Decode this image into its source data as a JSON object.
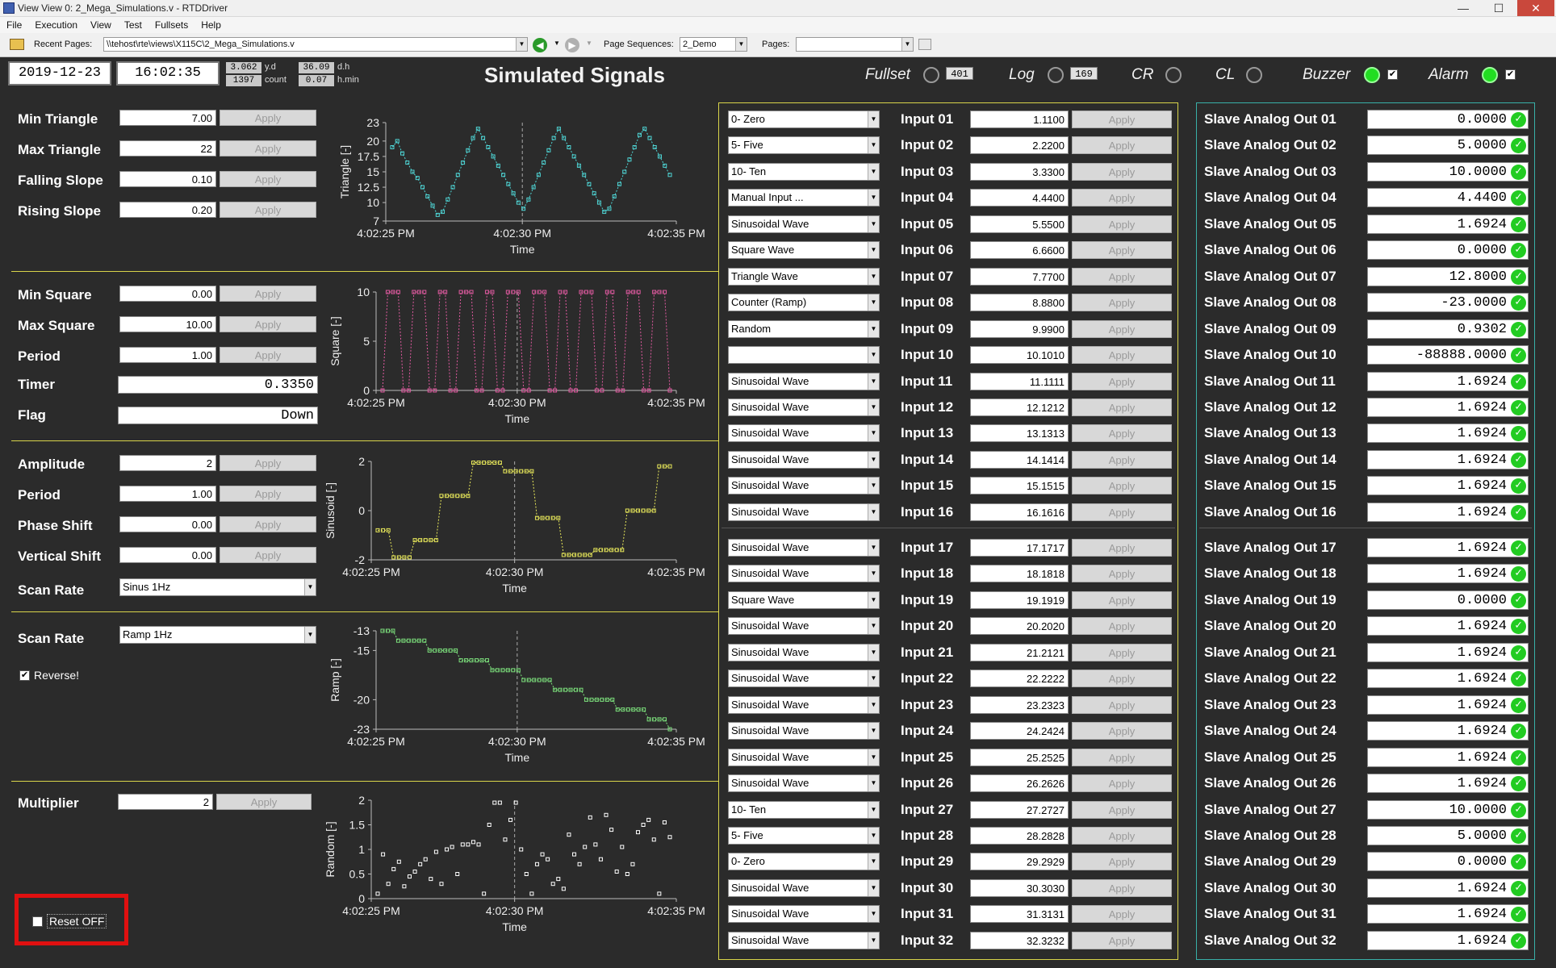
{
  "window": {
    "title": "View View 0: 2_Mega_Simulations.v - RTDDriver",
    "minimize": "—",
    "maximize": "☐",
    "close": "✕"
  },
  "menu": [
    "File",
    "Execution",
    "View",
    "Test",
    "Fullsets",
    "Help"
  ],
  "toolbar": {
    "recent_label": "Recent Pages:",
    "recent_value": "\\\\tehost\\rte\\views\\X115C\\2_Mega_Simulations.v",
    "page_seq_label": "Page Sequences:",
    "page_seq_value": "2_Demo",
    "pages_label": "Pages:",
    "pages_value": ""
  },
  "header": {
    "date": "2019-12-23",
    "time": "16:02:35",
    "yd": "3.062",
    "yd_unit": "y.d",
    "count": "1397",
    "count_unit": "count",
    "dh": "36.09",
    "dh_unit": "d.h",
    "hmin": "0.07",
    "hmin_unit": "h.min",
    "title": "Simulated Signals",
    "fullset_label": "Fullset",
    "fullset_value": "401",
    "log_label": "Log",
    "log_value": "169",
    "cr_label": "CR",
    "cl_label": "CL",
    "buzzer_label": "Buzzer",
    "alarm_label": "Alarm",
    "check_glyph": "✔"
  },
  "triangle": {
    "fields": [
      {
        "label": "Min Triangle",
        "value": "7.00"
      },
      {
        "label": "Max Triangle",
        "value": "22"
      },
      {
        "label": "Falling Slope",
        "value": "0.10"
      },
      {
        "label": "Rising Slope",
        "value": "0.20"
      }
    ]
  },
  "square": {
    "fields": [
      {
        "label": "Min Square",
        "value": "0.00"
      },
      {
        "label": "Max Square",
        "value": "10.00"
      },
      {
        "label": "Period",
        "value": "1.00"
      }
    ],
    "timer_label": "Timer",
    "timer_value": "0.3350",
    "flag_label": "Flag",
    "flag_value": "Down"
  },
  "sinus": {
    "fields": [
      {
        "label": "Amplitude",
        "value": "2"
      },
      {
        "label": "Period",
        "value": "1.00"
      },
      {
        "label": "Phase Shift",
        "value": "0.00"
      },
      {
        "label": "Vertical Shift",
        "value": "0.00"
      }
    ],
    "scan_label": "Scan Rate",
    "scan_value": "Sinus 1Hz"
  },
  "ramp": {
    "scan_label": "Scan Rate",
    "scan_value": "Ramp 1Hz",
    "reverse_label": "Reverse!"
  },
  "random": {
    "multiplier_label": "Multiplier",
    "multiplier_value": "2"
  },
  "apply_label": "Apply",
  "reset_label": "Reset OFF",
  "chart_data": [
    {
      "type": "line",
      "ylabel": "Triangle [-]",
      "xlabel": "Time",
      "xticks": [
        "4:02:25 PM",
        "4:02:30 PM",
        "4:02:35 PM"
      ],
      "yticks": [
        "7",
        "10",
        "12.5",
        "15",
        "17.5",
        "20",
        "23"
      ],
      "ylim": [
        7,
        23
      ],
      "color": "#4fd6d6",
      "values": [
        19,
        20,
        18,
        16.5,
        15,
        14,
        12.5,
        11,
        9.5,
        8,
        8.5,
        10.5,
        12.5,
        14.5,
        16.5,
        18.5,
        20.5,
        22,
        20.5,
        19,
        17.5,
        16,
        14.5,
        13,
        11.5,
        10,
        9,
        10.5,
        12.5,
        14.5,
        16.5,
        18.5,
        20.5,
        22,
        20.5,
        19,
        17.5,
        16,
        14.5,
        13,
        11.5,
        10,
        8.5,
        9,
        11,
        13,
        15,
        17,
        19,
        21,
        22,
        20.5,
        19,
        17.5,
        16,
        14.5
      ]
    },
    {
      "type": "line",
      "ylabel": "Square [-]",
      "xlabel": "Time",
      "xticks": [
        "4:02:25 PM",
        "4:02:30 PM",
        "4:02:35 PM"
      ],
      "yticks": [
        "0",
        "5",
        "10"
      ],
      "ylim": [
        0,
        10
      ],
      "color": "#e05aa0",
      "values": [
        0,
        10,
        10,
        10,
        0,
        0,
        10,
        10,
        10,
        0,
        0,
        10,
        10,
        0,
        0,
        10,
        10,
        10,
        0,
        0,
        10,
        10,
        0,
        0,
        10,
        10,
        10,
        0,
        0,
        10,
        10,
        10,
        0,
        0,
        10,
        10,
        0,
        0,
        10,
        10,
        10,
        0,
        0,
        10,
        10,
        0,
        0,
        10,
        10,
        10,
        0,
        0,
        10,
        10,
        10,
        0
      ]
    },
    {
      "type": "line",
      "ylabel": "Sinusoid [-]",
      "xlabel": "Time",
      "xticks": [
        "4:02:25 PM",
        "4:02:30 PM",
        "4:02:35 PM"
      ],
      "yticks": [
        "-2",
        "0",
        "2"
      ],
      "ylim": [
        -2,
        2
      ],
      "color": "#e8e85a",
      "values": [
        -0.8,
        -0.8,
        -0.8,
        -1.9,
        -1.9,
        -1.9,
        -1.9,
        -1.2,
        -1.2,
        -1.2,
        -1.2,
        -1.2,
        0.6,
        0.6,
        0.6,
        0.6,
        0.6,
        0.6,
        1.95,
        1.95,
        1.95,
        1.95,
        1.95,
        1.95,
        1.6,
        1.6,
        1.6,
        1.6,
        1.6,
        1.6,
        -0.3,
        -0.3,
        -0.3,
        -0.3,
        -0.3,
        -1.8,
        -1.8,
        -1.8,
        -1.8,
        -1.8,
        -1.8,
        -1.6,
        -1.6,
        -1.6,
        -1.6,
        -1.6,
        -1.6,
        0,
        0,
        0,
        0,
        0,
        0,
        1.8,
        1.8,
        1.8
      ]
    },
    {
      "type": "line",
      "ylabel": "Ramp [-]",
      "xlabel": "Time",
      "xticks": [
        "4:02:25 PM",
        "4:02:30 PM",
        "4:02:35 PM"
      ],
      "yticks": [
        "-13",
        "-15",
        "-20",
        "-23"
      ],
      "ylim": [
        -23,
        -13
      ],
      "color": "#7ce07c",
      "values": [
        -13,
        -13,
        -13,
        -14,
        -14,
        -14,
        -14,
        -14,
        -14,
        -15,
        -15,
        -15,
        -15,
        -15,
        -15,
        -16,
        -16,
        -16,
        -16,
        -16,
        -16,
        -17,
        -17,
        -17,
        -17,
        -17,
        -17,
        -18,
        -18,
        -18,
        -18,
        -18,
        -18,
        -19,
        -19,
        -19,
        -19,
        -19,
        -19,
        -20,
        -20,
        -20,
        -20,
        -20,
        -20,
        -21,
        -21,
        -21,
        -21,
        -21,
        -21,
        -22,
        -22,
        -22,
        -22,
        -23
      ]
    },
    {
      "type": "scatter",
      "ylabel": "Random [-]",
      "xlabel": "Time",
      "xticks": [
        "4:02:25 PM",
        "4:02:30 PM",
        "4:02:35 PM"
      ],
      "yticks": [
        "0",
        "0.5",
        "1",
        "1.5",
        "2"
      ],
      "ylim": [
        0,
        2
      ],
      "color": "#ffffff",
      "values": [
        0.1,
        0.9,
        0.3,
        0.6,
        0.75,
        0.25,
        0.45,
        0.55,
        0.7,
        0.8,
        0.4,
        0.95,
        0.3,
        1.0,
        1.05,
        0.5,
        1.1,
        1.1,
        1.15,
        1.1,
        0.1,
        1.5,
        1.95,
        1.95,
        1.2,
        1.6,
        1.95,
        1.0,
        0.5,
        0.1,
        0.7,
        0.9,
        0.8,
        0.3,
        0.4,
        0.2,
        1.3,
        0.9,
        0.7,
        1.05,
        1.65,
        1.1,
        0.8,
        1.7,
        1.4,
        0.55,
        1.05,
        0.5,
        0.7,
        1.35,
        1.5,
        1.6,
        1.2,
        0.1,
        1.55,
        1.25
      ]
    }
  ],
  "inputs": [
    {
      "mode": "0- Zero",
      "label": "Input 01",
      "value": "1.1100"
    },
    {
      "mode": "5- Five",
      "label": "Input 02",
      "value": "2.2200"
    },
    {
      "mode": "10- Ten",
      "label": "Input 03",
      "value": "3.3300"
    },
    {
      "mode": "Manual Input ...",
      "label": "Input 04",
      "value": "4.4400"
    },
    {
      "mode": "Sinusoidal Wave",
      "label": "Input 05",
      "value": "5.5500"
    },
    {
      "mode": "Square Wave",
      "label": "Input 06",
      "value": "6.6600"
    },
    {
      "mode": "Triangle Wave",
      "label": "Input 07",
      "value": "7.7700"
    },
    {
      "mode": "Counter (Ramp)",
      "label": "Input 08",
      "value": "8.8800"
    },
    {
      "mode": "Random",
      "label": "Input 09",
      "value": "9.9900"
    },
    {
      "mode": "",
      "label": "Input 10",
      "value": "10.1010"
    },
    {
      "mode": "Sinusoidal Wave",
      "label": "Input 11",
      "value": "11.1111"
    },
    {
      "mode": "Sinusoidal Wave",
      "label": "Input 12",
      "value": "12.1212"
    },
    {
      "mode": "Sinusoidal Wave",
      "label": "Input 13",
      "value": "13.1313"
    },
    {
      "mode": "Sinusoidal Wave",
      "label": "Input 14",
      "value": "14.1414"
    },
    {
      "mode": "Sinusoidal Wave",
      "label": "Input 15",
      "value": "15.1515"
    },
    {
      "mode": "Sinusoidal Wave",
      "label": "Input 16",
      "value": "16.1616"
    },
    {
      "mode": "Sinusoidal Wave",
      "label": "Input 17",
      "value": "17.1717"
    },
    {
      "mode": "Sinusoidal Wave",
      "label": "Input 18",
      "value": "18.1818"
    },
    {
      "mode": "Square Wave",
      "label": "Input 19",
      "value": "19.1919"
    },
    {
      "mode": "Sinusoidal Wave",
      "label": "Input 20",
      "value": "20.2020"
    },
    {
      "mode": "Sinusoidal Wave",
      "label": "Input 21",
      "value": "21.2121"
    },
    {
      "mode": "Sinusoidal Wave",
      "label": "Input 22",
      "value": "22.2222"
    },
    {
      "mode": "Sinusoidal Wave",
      "label": "Input 23",
      "value": "23.2323"
    },
    {
      "mode": "Sinusoidal Wave",
      "label": "Input 24",
      "value": "24.2424"
    },
    {
      "mode": "Sinusoidal Wave",
      "label": "Input 25",
      "value": "25.2525"
    },
    {
      "mode": "Sinusoidal Wave",
      "label": "Input 26",
      "value": "26.2626"
    },
    {
      "mode": "10- Ten",
      "label": "Input 27",
      "value": "27.2727"
    },
    {
      "mode": "5- Five",
      "label": "Input 28",
      "value": "28.2828"
    },
    {
      "mode": "0- Zero",
      "label": "Input 29",
      "value": "29.2929"
    },
    {
      "mode": "Sinusoidal Wave",
      "label": "Input 30",
      "value": "30.3030"
    },
    {
      "mode": "Sinusoidal Wave",
      "label": "Input 31",
      "value": "31.3131"
    },
    {
      "mode": "Sinusoidal Wave",
      "label": "Input 32",
      "value": "32.3232"
    }
  ],
  "outputs": [
    {
      "label": "Slave Analog Out 01",
      "value": "0.0000"
    },
    {
      "label": "Slave Analog Out 02",
      "value": "5.0000"
    },
    {
      "label": "Slave Analog Out 03",
      "value": "10.0000"
    },
    {
      "label": "Slave Analog Out 04",
      "value": "4.4400"
    },
    {
      "label": "Slave Analog Out 05",
      "value": "1.6924"
    },
    {
      "label": "Slave Analog Out 06",
      "value": "0.0000"
    },
    {
      "label": "Slave Analog Out 07",
      "value": "12.8000"
    },
    {
      "label": "Slave Analog Out 08",
      "value": "-23.0000"
    },
    {
      "label": "Slave Analog Out 09",
      "value": "0.9302"
    },
    {
      "label": "Slave Analog Out 10",
      "value": "-88888.0000"
    },
    {
      "label": "Slave Analog Out 11",
      "value": "1.6924"
    },
    {
      "label": "Slave Analog Out 12",
      "value": "1.6924"
    },
    {
      "label": "Slave Analog Out 13",
      "value": "1.6924"
    },
    {
      "label": "Slave Analog Out 14",
      "value": "1.6924"
    },
    {
      "label": "Slave Analog Out 15",
      "value": "1.6924"
    },
    {
      "label": "Slave Analog Out 16",
      "value": "1.6924"
    },
    {
      "label": "Slave Analog Out 17",
      "value": "1.6924"
    },
    {
      "label": "Slave Analog Out 18",
      "value": "1.6924"
    },
    {
      "label": "Slave Analog Out 19",
      "value": "0.0000"
    },
    {
      "label": "Slave Analog Out 20",
      "value": "1.6924"
    },
    {
      "label": "Slave Analog Out 21",
      "value": "1.6924"
    },
    {
      "label": "Slave Analog Out 22",
      "value": "1.6924"
    },
    {
      "label": "Slave Analog Out 23",
      "value": "1.6924"
    },
    {
      "label": "Slave Analog Out 24",
      "value": "1.6924"
    },
    {
      "label": "Slave Analog Out 25",
      "value": "1.6924"
    },
    {
      "label": "Slave Analog Out 26",
      "value": "1.6924"
    },
    {
      "label": "Slave Analog Out 27",
      "value": "10.0000"
    },
    {
      "label": "Slave Analog Out 28",
      "value": "5.0000"
    },
    {
      "label": "Slave Analog Out 29",
      "value": "0.0000"
    },
    {
      "label": "Slave Analog Out 30",
      "value": "1.6924"
    },
    {
      "label": "Slave Analog Out 31",
      "value": "1.6924"
    },
    {
      "label": "Slave Analog Out 32",
      "value": "1.6924"
    }
  ],
  "colors": {
    "panel_line": "#d8d44a",
    "output_frame": "#39b0a8",
    "led_on": "#22dd22",
    "highlight": "#e01010"
  }
}
